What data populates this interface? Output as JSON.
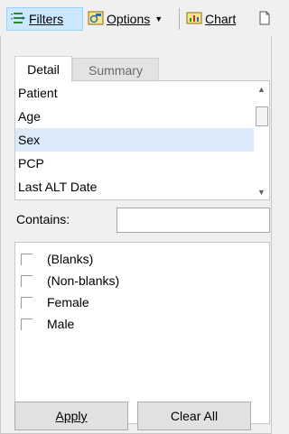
{
  "toolbar": {
    "filters_label": "Filters",
    "options_label": "Options",
    "chart_label": "Chart"
  },
  "tabs": [
    {
      "label": "Detail",
      "selected": true
    },
    {
      "label": "Summary",
      "selected": false
    }
  ],
  "fields": [
    {
      "label": "Patient"
    },
    {
      "label": "Age"
    },
    {
      "label": "Sex"
    },
    {
      "label": "PCP"
    },
    {
      "label": "Last ALT Date"
    }
  ],
  "selected_field": "Sex",
  "contains": {
    "label": "Contains:",
    "value": ""
  },
  "values": [
    {
      "label": "(Blanks)"
    },
    {
      "label": "(Non-blanks)"
    },
    {
      "label": "Female"
    },
    {
      "label": "Male"
    }
  ],
  "buttons": {
    "apply_label": "Apply",
    "clear_label": "Clear All"
  },
  "colors": {
    "accent": "#cce8ff",
    "selection": "#dce9f8"
  },
  "icons": [
    "filter-icon",
    "options-icon",
    "chart-icon",
    "document-icon"
  ]
}
